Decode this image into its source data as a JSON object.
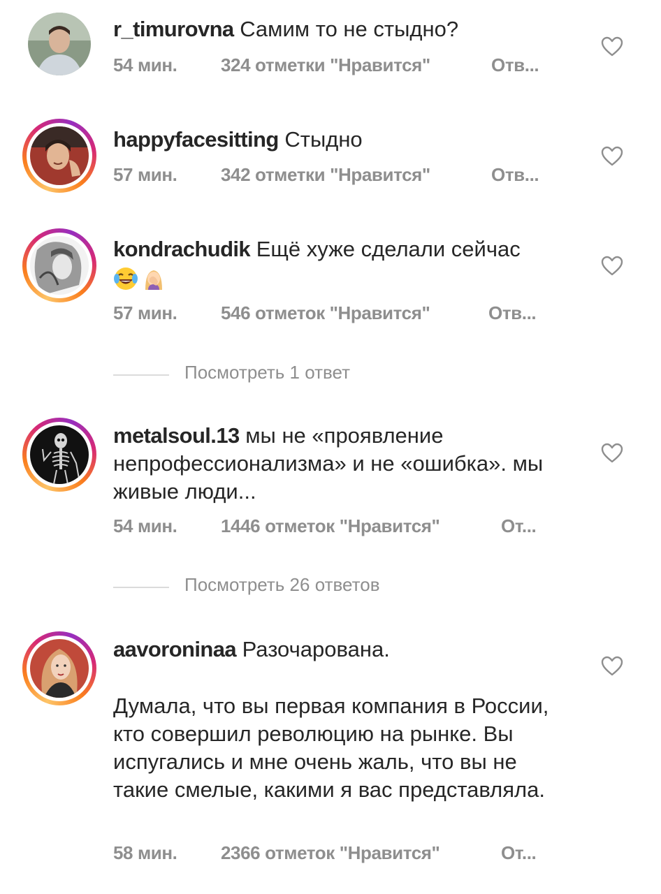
{
  "comments": [
    {
      "username": "r_timurovna",
      "text": "Самим то не стыдно?",
      "time": "54 мин.",
      "likes": "324 отметки \"Нравится\"",
      "reply": "Отв..."
    },
    {
      "username": "happyfacesitting",
      "text": "Стыдно",
      "time": "57 мин.",
      "likes": "342 отметки \"Нравится\"",
      "reply": "Отв..."
    },
    {
      "username": "kondrachudik",
      "text": "Ещё хуже сделали сейчас",
      "emoji": [
        "face-with-tears-of-joy-emoji",
        "woman-facepalming-emoji"
      ],
      "time": "57 мин.",
      "likes": "546 отметок \"Нравится\"",
      "reply": "Отв..."
    },
    {
      "username": "metalsoul.13",
      "text": "мы не «проявление непрофессионализма» и не «ошибка». мы живые люди...",
      "time": "54 мин.",
      "likes": "1446 отметок \"Нравится\"",
      "reply": "От..."
    },
    {
      "username": "aavoroninaa",
      "text": "Разочарована.",
      "text2": "Думала, что вы первая компания в России, кто совершил революцию на рынке. Вы испугались и мне очень жаль, что вы не такие смелые, какими я вас представляла.",
      "time": "58 мин.",
      "likes": "2366 отметок \"Нравится\"",
      "reply": "От..."
    }
  ],
  "view_replies": [
    "Посмотреть 1 ответ",
    "Посмотреть 26 ответов"
  ],
  "icons": {
    "like": "heart-outline-icon"
  },
  "colors": {
    "text": "#262626",
    "meta": "#8e8e8e",
    "story_ring": [
      "#fdc468",
      "#fa7e1e",
      "#d62976",
      "#962fbf"
    ]
  }
}
